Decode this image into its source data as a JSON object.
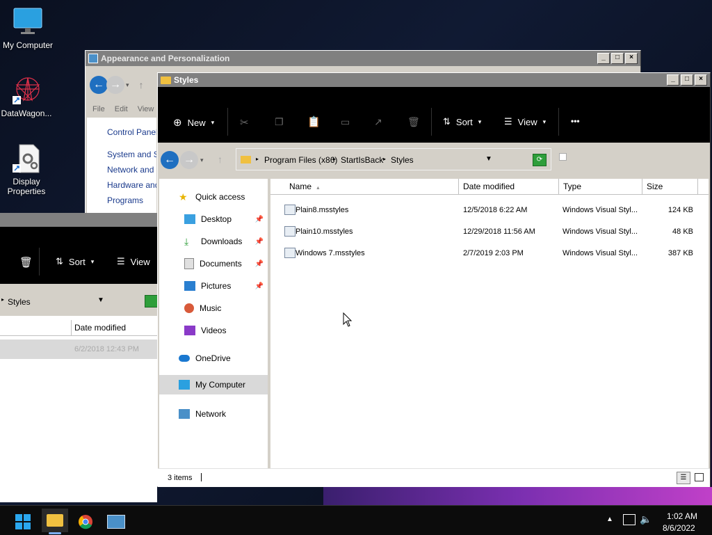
{
  "desktop": {
    "icons": [
      {
        "label": "My Computer"
      },
      {
        "label": "DataWagon..."
      },
      {
        "label": "Display Properties"
      }
    ]
  },
  "back_window": {
    "title": "Appearance and Personalization",
    "menu": [
      "File",
      "Edit",
      "View"
    ],
    "links": [
      "Control Panel H",
      "System and Se",
      "Network and In",
      "Hardware and",
      "Programs"
    ]
  },
  "behind_window": {
    "toolbar": {
      "sort": "Sort",
      "view": "View"
    },
    "address_tail": "Styles",
    "col_date": "Date modified",
    "row_date": "6/2/2018 12:43 PM"
  },
  "main_window": {
    "title": "Styles",
    "toolbar": {
      "new": "New",
      "sort": "Sort",
      "view": "View",
      "more": "•••"
    },
    "address": {
      "crumbs": [
        "Program Files (x86)",
        "StartIsBack",
        "Styles"
      ]
    },
    "nav": {
      "quick_access": "Quick access",
      "desktop": "Desktop",
      "downloads": "Downloads",
      "documents": "Documents",
      "pictures": "Pictures",
      "music": "Music",
      "videos": "Videos",
      "onedrive": "OneDrive",
      "my_computer": "My Computer",
      "network": "Network"
    },
    "columns": {
      "name": "Name",
      "date": "Date modified",
      "type": "Type",
      "size": "Size"
    },
    "files": [
      {
        "name": "Plain8.msstyles",
        "date": "12/5/2018 6:22 AM",
        "type": "Windows Visual Styl...",
        "size": "124 KB"
      },
      {
        "name": "Plain10.msstyles",
        "date": "12/29/2018 11:56 AM",
        "type": "Windows Visual Styl...",
        "size": "48 KB"
      },
      {
        "name": "Windows 7.msstyles",
        "date": "2/7/2019 2:03 PM",
        "type": "Windows Visual Styl...",
        "size": "387 KB"
      }
    ],
    "status": "3 items"
  },
  "taskbar": {
    "time": "1:02 AM",
    "date": "8/6/2022"
  },
  "colors": {
    "titlebar": "#808080",
    "toolbar_bg": "#000000",
    "face": "#d4d0c8",
    "taskbar": "#0c0c0c",
    "accent": "#0078d7"
  }
}
